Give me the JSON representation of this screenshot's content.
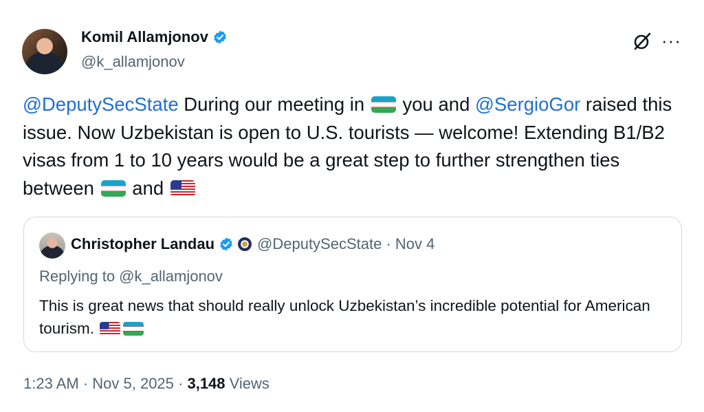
{
  "author": {
    "name": "Komil Allamjonov",
    "handle": "@k_allamjonov"
  },
  "tweet": {
    "mention1": "@DeputySecState",
    "text1": " During our meeting in ",
    "text2": " you and ",
    "mention2": "@SergioGor",
    "text3": " raised this issue. Now Uzbekistan is open to U.S. tourists — welcome! Extending B1/B2 visas from 1 to 10 years would be a great step to further strengthen ties between ",
    "text4": " and "
  },
  "quote": {
    "name": "Christopher Landau",
    "handle_date": "@DeputySecState · Nov 4",
    "replying": "Replying to @k_allamjonov",
    "text": "This is great news that should really unlock Uzbekistan’s incredible potential for American tourism. "
  },
  "footer": {
    "time_date": "1:23 AM · Nov 5, 2025 · ",
    "views_count": "3,148",
    "views_label": " Views"
  },
  "icons": {
    "verified": "verified-badge-icon",
    "grok": "grok-icon",
    "more": "more-icon",
    "flag_uz": "uzbekistan-flag-icon",
    "flag_us": "us-flag-icon",
    "seal": "state-department-seal-icon"
  },
  "colors": {
    "link": "#1d6fd6",
    "muted": "#536471",
    "verified": "#1d9bf0"
  }
}
